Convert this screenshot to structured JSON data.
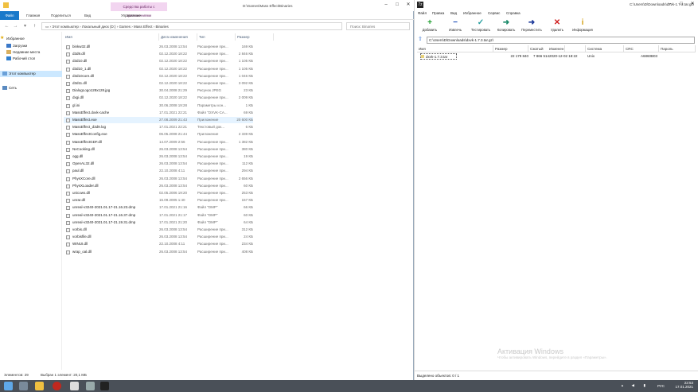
{
  "explorer": {
    "title_path": "D:\\Games\\Mass Effect\\Binaries",
    "tools_tab": "Средства работы с приложениями",
    "ribbon_tabs": [
      "Файл",
      "Главная",
      "Поделиться",
      "Вид",
      "Управление"
    ],
    "address": [
      "Этот компьютер",
      "Локальный диск (D:)",
      "Games",
      "Mass Effect",
      "Binaries"
    ],
    "search_placeholder": "Поиск: Binaries",
    "nav": {
      "favorites": "Избранное",
      "downloads": "Загрузки",
      "recent": "Недавние места",
      "desktop": "Рабочий стол",
      "this_pc": "Этот компьютер",
      "network": "Сеть"
    },
    "columns": [
      "Имя",
      "Дата изменения",
      "Тип",
      "Размер"
    ],
    "files": [
      {
        "name": "binkw32.dll",
        "date": "26.03.2008 13:54",
        "type": "Расширение при...",
        "size": "169 КБ"
      },
      {
        "name": "d3d9.dll",
        "date": "02.12.2020 18:22",
        "type": "Расширение при...",
        "size": "2 846 КБ"
      },
      {
        "name": "d3d10.dll",
        "date": "02.12.2020 18:22",
        "type": "Расширение при...",
        "size": "1 105 КБ"
      },
      {
        "name": "d3d10_1.dll",
        "date": "02.12.2020 18:22",
        "type": "Расширение при...",
        "size": "1 105 КБ"
      },
      {
        "name": "d3d10core.dll",
        "date": "02.12.2020 18:22",
        "type": "Расширение при...",
        "size": "1 046 КБ"
      },
      {
        "name": "d3d11.dll",
        "date": "02.12.2020 18:22",
        "type": "Расширение при...",
        "size": "3 092 КБ"
      },
      {
        "name": "DialogLogo128x128.jpg",
        "date": "30.04.2008 21:29",
        "type": "Рисунок JPEG",
        "size": "23 КБ"
      },
      {
        "name": "dxgi.dll",
        "date": "02.12.2020 18:22",
        "type": "Расширение при...",
        "size": "2 009 КБ"
      },
      {
        "name": "gl.ini",
        "date": "30.06.2008 19:28",
        "type": "Параметры кон...",
        "size": "1 КБ"
      },
      {
        "name": "MassEffect.dxvk-cache",
        "date": "17.01.2021 22:21",
        "type": "Файл \"DXVK-CA...",
        "size": "69 КБ"
      },
      {
        "name": "MassEffect.exe",
        "date": "27.08.2009 21:43",
        "type": "Приложение",
        "size": "20 600 КБ",
        "selected": true
      },
      {
        "name": "MassEffect_d3d9.log",
        "date": "17.01.2021 22:21",
        "type": "Текстовый док...",
        "size": "6 КБ"
      },
      {
        "name": "MassEffectConfig.exe",
        "date": "06.05.2008 21:44",
        "type": "Приложение",
        "size": "2 339 КБ"
      },
      {
        "name": "MassEffectGDF.dll",
        "date": "14.07.2009 2:56",
        "type": "Расширение при...",
        "size": "1 382 КБ"
      },
      {
        "name": "NxCooking.dll",
        "date": "26.03.2008 13:54",
        "type": "Расширение при...",
        "size": "380 КБ"
      },
      {
        "name": "ogg.dll",
        "date": "26.03.2008 13:54",
        "type": "Расширение при...",
        "size": "19 КБ"
      },
      {
        "name": "OpenAL32.dll",
        "date": "26.03.2008 13:54",
        "type": "Расширение при...",
        "size": "112 КБ"
      },
      {
        "name": "paul.dll",
        "date": "22.10.2008 4:11",
        "type": "Расширение при...",
        "size": "294 КБ"
      },
      {
        "name": "PhysXCore.dll",
        "date": "26.03.2008 13:54",
        "type": "Расширение при...",
        "size": "2 656 КБ"
      },
      {
        "name": "PhysXLoader.dll",
        "date": "26.03.2008 13:54",
        "type": "Расширение при...",
        "size": "60 КБ"
      },
      {
        "name": "unicows.dll",
        "date": "02.05.2006 19:20",
        "type": "Расширение при...",
        "size": "253 КБ"
      },
      {
        "name": "unrar.dll",
        "date": "16.09.2005 1:40",
        "type": "Расширение при...",
        "size": "157 КБ"
      },
      {
        "name": "unreal-v3240-2021.01.17-21.16.23.dmp",
        "date": "17.01.2021 21:16",
        "type": "Файл \"DMP\"",
        "size": "66 КБ"
      },
      {
        "name": "unreal-v3240-2021.01.17-21.16.37.dmp",
        "date": "17.01.2021 21:17",
        "type": "Файл \"DMP\"",
        "size": "60 КБ"
      },
      {
        "name": "unreal-v3240-2021.01.17-21.19.31.dmp",
        "date": "17.01.2021 21:20",
        "type": "Файл \"DMP\"",
        "size": "64 КБ"
      },
      {
        "name": "vorbis.dll",
        "date": "26.03.2008 13:54",
        "type": "Расширение при...",
        "size": "312 КБ"
      },
      {
        "name": "vorbisfile.dll",
        "date": "26.03.2008 13:54",
        "type": "Расширение при...",
        "size": "24 КБ"
      },
      {
        "name": "WINUI.dll",
        "date": "22.10.2008 4:11",
        "type": "Расширение при...",
        "size": "234 КБ"
      },
      {
        "name": "wrap_oal.dll",
        "date": "26.03.2008 13:54",
        "type": "Расширение при...",
        "size": "408 КБ"
      }
    ],
    "status_count": "Элементов: 29",
    "status_selected": "Выбран 1 элемент: 20,1 МБ"
  },
  "zip": {
    "title": "C:\\Users\\D\\Downloads\\dxvk-1.7.3.tar.gz\\",
    "menu": [
      "Файл",
      "Правка",
      "Вид",
      "Избранное",
      "Сервис",
      "Справка"
    ],
    "tools": [
      {
        "label": "Добавить",
        "glyph": "+",
        "color": "#1e9e2e"
      },
      {
        "label": "Извлечь",
        "glyph": "−",
        "color": "#1d4fb8"
      },
      {
        "label": "Тестировать",
        "glyph": "✓",
        "color": "#2aa0a0"
      },
      {
        "label": "Копировать",
        "glyph": "➜",
        "color": "#1b8a6a"
      },
      {
        "label": "Переместить",
        "glyph": "➜",
        "color": "#1d3a9a"
      },
      {
        "label": "Удалить",
        "glyph": "✕",
        "color": "#d02020"
      },
      {
        "label": "Информация",
        "glyph": "i",
        "color": "#d4a017"
      }
    ],
    "address": "C:\\Users\\D\\Downloads\\dxvk-1.7.3.tar.gz\\",
    "columns": [
      "Имя",
      "Размер",
      "Сжатый",
      "Изменен",
      "Система",
      "CRC",
      "Пароль"
    ],
    "rows": [
      {
        "name": "dxvk-1.7.3.tar",
        "size": "22 179 840",
        "packed": "7 866 514",
        "modified": "2020-12-02 18:22",
        "system": "Unix",
        "crc": "A6860B03",
        "pass": ""
      }
    ],
    "status": "Выделено объектов: 0 / 1"
  },
  "watermark": {
    "title": "Активация Windows",
    "subtitle": "Чтобы активировать Windows, перейдите в раздел «Параметры»."
  },
  "taskbar": {
    "lang": "РУС",
    "time": "22:53",
    "date": "17.01.2021"
  }
}
